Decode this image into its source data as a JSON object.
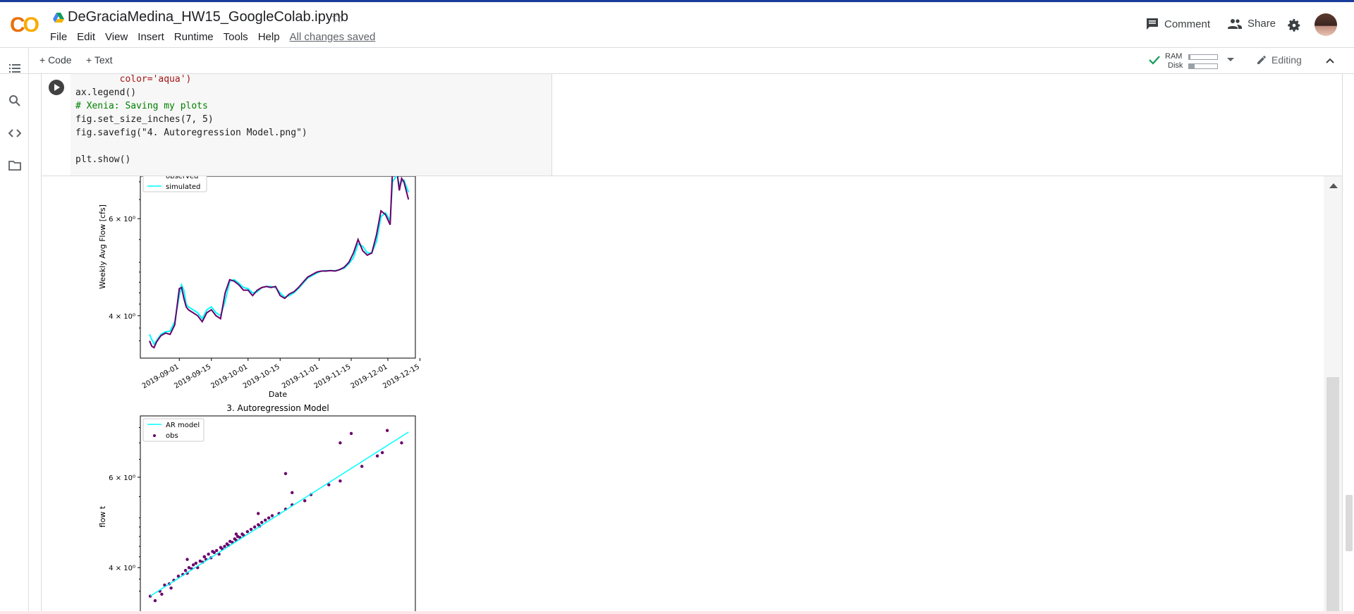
{
  "header": {
    "notebook_title": "DeGracia​Medina_HW15_GoogleColab.ipynb",
    "menu": [
      "File",
      "Edit",
      "View",
      "Insert",
      "Runtime",
      "Tools",
      "Help"
    ],
    "save_status": "All changes saved",
    "comment_label": "Comment",
    "share_label": "Share"
  },
  "toolbar": {
    "add_code_label": "+ Code",
    "add_text_label": "+ Text",
    "ram_label": "RAM",
    "disk_label": "Disk",
    "ram_fraction": 0.05,
    "disk_fraction": 0.2,
    "editing_label": "Editing"
  },
  "sidebar": {
    "icons": [
      "table-of-contents-icon",
      "search-icon",
      "code-snippets-icon",
      "files-icon"
    ]
  },
  "code_cell": {
    "lines": [
      "        color='aqua')",
      "ax.legend()",
      "# Xenia: Saving my plots",
      "fig.set_size_inches(7, 5)",
      "fig.savefig(\"4. Autoregression Model.png\")",
      "",
      "plt.show()"
    ]
  },
  "colors": {
    "observed": "#6a006a",
    "simulated": "#00ffff",
    "accent": "#1a73e8",
    "logo_orange": "#e8710a",
    "logo_yellow": "#f9ab00"
  },
  "chart_data": [
    {
      "type": "line",
      "title": "",
      "xlabel": "Date",
      "ylabel": "Weekly Avg Flow [cfs]",
      "yscale": "log",
      "ytick_labels": [
        "4 × 10⁰",
        "6 × 10⁰"
      ],
      "ytick_values": [
        4,
        6
      ],
      "xtick_labels": [
        "2019-09-01",
        "2019-09-15",
        "2019-10-01",
        "2019-10-15",
        "2019-11-01",
        "2019-11-15",
        "2019-12-01",
        "2019-12-15"
      ],
      "legend": [
        "observed",
        "simulated"
      ],
      "legend_position": "upper-left",
      "series": [
        {
          "name": "observed",
          "x": [
            "2019-08-19",
            "2019-08-20",
            "2019-08-21",
            "2019-08-22",
            "2019-08-24",
            "2019-08-26",
            "2019-08-28",
            "2019-08-30",
            "2019-09-01",
            "2019-09-02",
            "2019-09-03",
            "2019-09-04",
            "2019-09-05",
            "2019-09-07",
            "2019-09-09",
            "2019-09-11",
            "2019-09-13",
            "2019-09-15",
            "2019-09-17",
            "2019-09-19",
            "2019-09-21",
            "2019-09-23",
            "2019-09-25",
            "2019-09-27",
            "2019-09-29",
            "2019-10-01",
            "2019-10-03",
            "2019-10-05",
            "2019-10-07",
            "2019-10-09",
            "2019-10-11",
            "2019-10-13",
            "2019-10-15",
            "2019-10-17",
            "2019-10-19",
            "2019-10-21",
            "2019-10-23",
            "2019-10-25",
            "2019-10-27",
            "2019-10-29",
            "2019-10-31",
            "2019-11-02",
            "2019-11-04",
            "2019-11-06",
            "2019-11-08",
            "2019-11-10",
            "2019-11-12",
            "2019-11-14",
            "2019-11-16",
            "2019-11-18",
            "2019-11-20",
            "2019-11-22",
            "2019-11-24",
            "2019-11-26",
            "2019-11-28",
            "2019-11-30",
            "2019-12-02",
            "2019-12-03",
            "2019-12-05",
            "2019-12-06",
            "2019-12-07",
            "2019-12-08",
            "2019-12-10"
          ],
          "y": [
            3.6,
            3.52,
            3.5,
            3.58,
            3.68,
            3.72,
            3.7,
            3.85,
            4.48,
            4.5,
            4.3,
            4.15,
            4.1,
            4.05,
            4.0,
            3.9,
            4.05,
            4.1,
            4.0,
            3.95,
            4.4,
            4.65,
            4.62,
            4.55,
            4.45,
            4.45,
            4.35,
            4.45,
            4.5,
            4.52,
            4.5,
            4.52,
            4.35,
            4.3,
            4.38,
            4.42,
            4.5,
            4.6,
            4.7,
            4.75,
            4.8,
            4.82,
            4.82,
            4.83,
            4.82,
            4.85,
            4.9,
            5.0,
            5.2,
            5.5,
            5.25,
            5.15,
            5.2,
            5.6,
            6.2,
            6.1,
            5.85,
            7.3,
            7.3,
            6.75,
            7.1,
            7.0,
            6.5
          ]
        },
        {
          "name": "simulated",
          "x": [
            "2019-08-19",
            "2019-08-20",
            "2019-08-21",
            "2019-08-22",
            "2019-08-24",
            "2019-08-26",
            "2019-08-28",
            "2019-08-30",
            "2019-09-01",
            "2019-09-02",
            "2019-09-03",
            "2019-09-04",
            "2019-09-05",
            "2019-09-07",
            "2019-09-09",
            "2019-09-11",
            "2019-09-13",
            "2019-09-15",
            "2019-09-17",
            "2019-09-19",
            "2019-09-21",
            "2019-09-23",
            "2019-09-25",
            "2019-09-27",
            "2019-09-29",
            "2019-10-01",
            "2019-10-03",
            "2019-10-05",
            "2019-10-07",
            "2019-10-09",
            "2019-10-11",
            "2019-10-13",
            "2019-10-15",
            "2019-10-17",
            "2019-10-19",
            "2019-10-21",
            "2019-10-23",
            "2019-10-25",
            "2019-10-27",
            "2019-10-29",
            "2019-10-31",
            "2019-11-02",
            "2019-11-04",
            "2019-11-06",
            "2019-11-08",
            "2019-11-10",
            "2019-11-12",
            "2019-11-14",
            "2019-11-16",
            "2019-11-18",
            "2019-11-20",
            "2019-11-22",
            "2019-11-24",
            "2019-11-26",
            "2019-11-28",
            "2019-11-30",
            "2019-12-02",
            "2019-12-03",
            "2019-12-05",
            "2019-12-06",
            "2019-12-07",
            "2019-12-08",
            "2019-12-10"
          ],
          "y": [
            3.7,
            3.62,
            3.55,
            3.6,
            3.7,
            3.74,
            3.75,
            3.9,
            4.35,
            4.55,
            4.45,
            4.2,
            4.15,
            4.1,
            4.05,
            3.95,
            4.1,
            4.15,
            4.05,
            4.0,
            4.25,
            4.62,
            4.65,
            4.58,
            4.5,
            4.48,
            4.4,
            4.42,
            4.5,
            4.52,
            4.52,
            4.5,
            4.4,
            4.32,
            4.35,
            4.4,
            4.48,
            4.58,
            4.68,
            4.73,
            4.78,
            4.82,
            4.83,
            4.83,
            4.83,
            4.85,
            4.88,
            4.97,
            5.1,
            5.4,
            5.35,
            5.2,
            5.2,
            5.45,
            6.05,
            6.15,
            5.95,
            7.0,
            7.2,
            6.9,
            7.0,
            7.05,
            6.7
          ]
        }
      ]
    },
    {
      "type": "scatter",
      "title": "3. Autoregression Model",
      "xlabel": "",
      "ylabel": "flow t",
      "yscale": "log",
      "ytick_labels": [
        "4 × 10⁰",
        "6 × 10⁰"
      ],
      "ytick_values": [
        4,
        6
      ],
      "xlim": [
        3.4,
        7.6
      ],
      "ylim": [
        3.4,
        7.6
      ],
      "legend": [
        "AR model",
        "obs"
      ],
      "legend_position": "upper-left",
      "line": {
        "name": "AR model",
        "x": [
          3.5,
          7.45
        ],
        "y": [
          3.52,
          7.35
        ]
      },
      "points": {
        "name": "obs",
        "x": [
          3.5,
          3.55,
          3.6,
          3.62,
          3.65,
          3.7,
          3.72,
          3.75,
          3.8,
          3.85,
          3.88,
          3.9,
          3.92,
          3.95,
          3.97,
          4.0,
          4.02,
          4.05,
          4.08,
          4.1,
          4.12,
          4.15,
          4.18,
          4.2,
          4.22,
          4.25,
          4.28,
          4.3,
          4.32,
          4.35,
          4.38,
          4.4,
          4.42,
          4.45,
          4.48,
          4.5,
          4.52,
          4.55,
          4.58,
          4.6,
          4.65,
          4.7,
          4.75,
          4.8,
          4.82,
          4.85,
          4.9,
          4.95,
          5.0,
          5.1,
          5.2,
          5.3,
          5.5,
          5.6,
          5.9,
          6.1,
          6.5,
          6.9,
          7.3,
          7.0,
          6.3,
          6.1,
          6.8,
          5.2,
          4.5,
          4.1,
          3.9,
          4.8,
          5.3
        ],
        "y": [
          3.52,
          3.45,
          3.6,
          3.55,
          3.7,
          3.72,
          3.65,
          3.78,
          3.85,
          3.88,
          3.95,
          3.9,
          4.0,
          3.98,
          4.05,
          4.08,
          4.0,
          4.12,
          4.1,
          4.2,
          4.15,
          4.25,
          4.18,
          4.3,
          4.28,
          4.32,
          4.25,
          4.38,
          4.35,
          4.4,
          4.45,
          4.42,
          4.5,
          4.48,
          4.55,
          4.52,
          4.6,
          4.58,
          4.65,
          4.62,
          4.7,
          4.75,
          4.8,
          4.85,
          4.82,
          4.9,
          4.95,
          5.0,
          5.05,
          5.1,
          5.2,
          5.3,
          5.4,
          5.55,
          5.8,
          5.9,
          6.3,
          6.7,
          7.0,
          7.4,
          7.3,
          7.0,
          6.6,
          6.1,
          4.65,
          4.2,
          4.15,
          5.1,
          5.6
        ]
      }
    }
  ]
}
